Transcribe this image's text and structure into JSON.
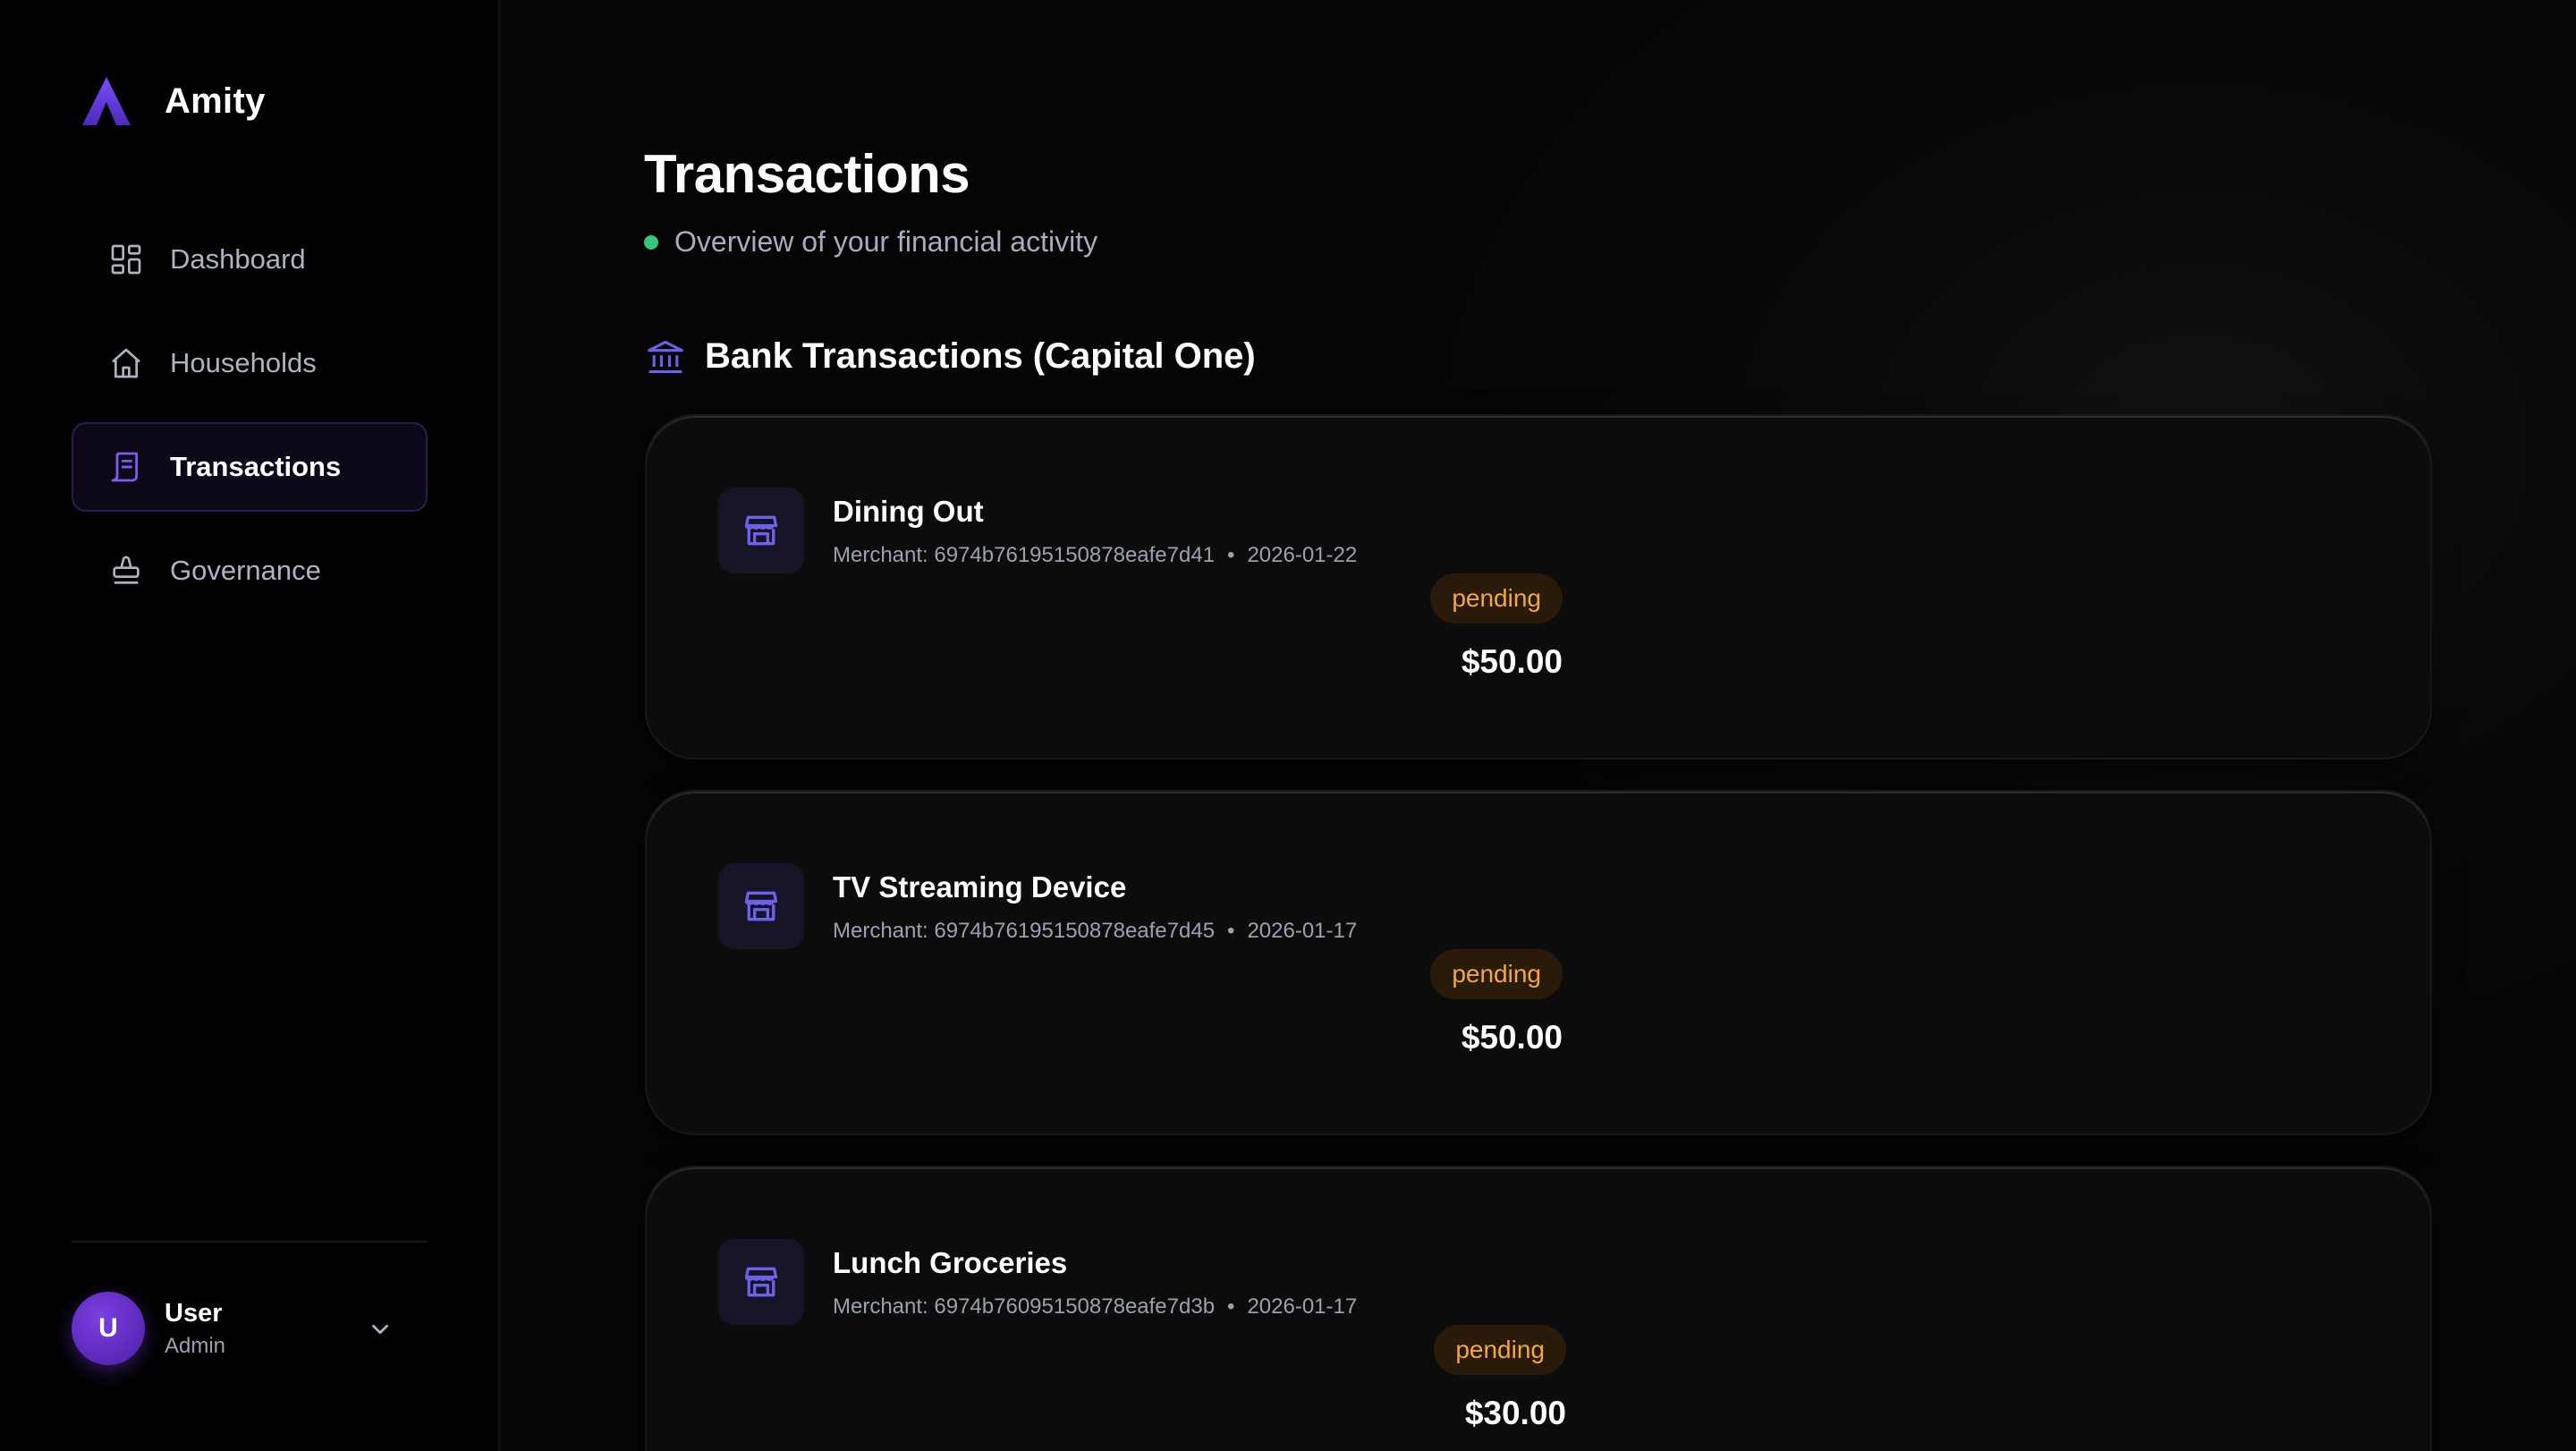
{
  "brand": {
    "name": "Amity",
    "logo_icon": "amity-logo-icon",
    "accent": "#6d3fe0"
  },
  "sidebar": {
    "items": [
      {
        "label": "Dashboard",
        "icon": "dashboard-icon",
        "active": false
      },
      {
        "label": "Households",
        "icon": "home-icon",
        "active": false
      },
      {
        "label": "Transactions",
        "icon": "receipt-icon",
        "active": true
      },
      {
        "label": "Governance",
        "icon": "stamp-icon",
        "active": false
      }
    ]
  },
  "user": {
    "initial": "U",
    "name": "User",
    "role": "Admin"
  },
  "page": {
    "title": "Transactions",
    "subtitle": "Overview of your financial activity",
    "status_color": "#34c77b"
  },
  "section": {
    "title": "Bank Transactions (Capital One)",
    "icon": "bank-icon"
  },
  "transactions": [
    {
      "name": "Dining Out",
      "merchant": "Merchant: 6974b76195150878eafe7d41",
      "separator": "•",
      "date": "2026-01-22",
      "status": "pending",
      "amount": "$50.00"
    },
    {
      "name": "TV Streaming Device",
      "merchant": "Merchant: 6974b76195150878eafe7d45",
      "separator": "•",
      "date": "2026-01-17",
      "status": "pending",
      "amount": "$50.00"
    },
    {
      "name": "Lunch Groceries",
      "merchant": "Merchant: 6974b76095150878eafe7d3b",
      "separator": "•",
      "date": "2026-01-17",
      "status": "pending",
      "amount": "$30.00"
    }
  ],
  "colors": {
    "pending_text": "#f2a93a",
    "pending_bg": "#2a1a0a",
    "icon_accent": "#6b62e8"
  }
}
